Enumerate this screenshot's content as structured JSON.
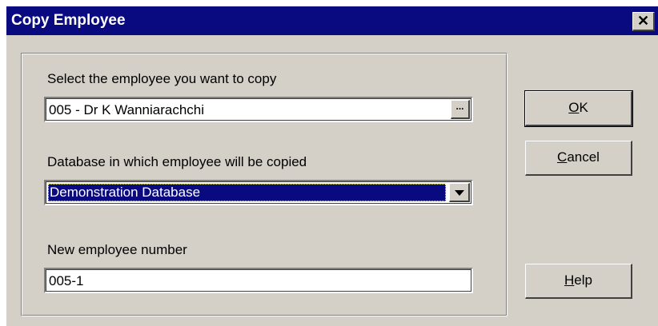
{
  "window": {
    "title": "Copy Employee",
    "close_glyph": "✕"
  },
  "form": {
    "employee_label": "Select the employee you want to copy",
    "employee_value": "005 - Dr K Wanniarachchi",
    "browse_label": "...",
    "database_label": "Database in which employee will be copied",
    "database_value": "Demonstration Database",
    "number_label": "New employee number",
    "number_value": "005-1"
  },
  "buttons": {
    "ok": {
      "mnemonic": "O",
      "rest": "K"
    },
    "cancel": {
      "mnemonic": "C",
      "rest": "ancel"
    },
    "help": {
      "mnemonic": "H",
      "rest": "elp"
    }
  },
  "colors": {
    "titlebar": "#0a0a80",
    "face": "#d4d0c8",
    "selection": "#0a0a80"
  }
}
